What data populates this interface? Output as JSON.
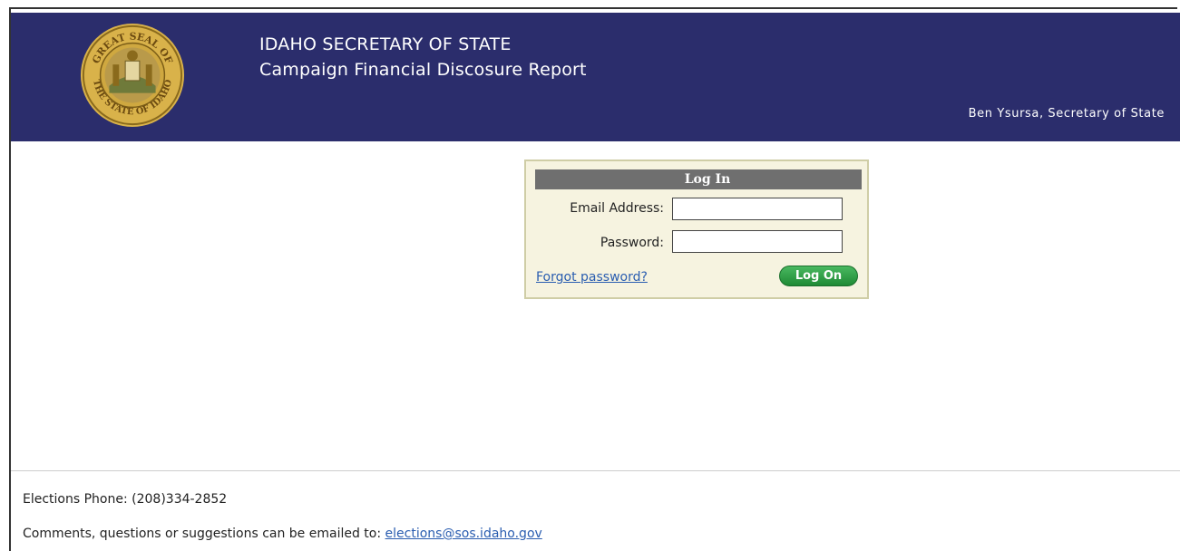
{
  "header": {
    "title_line1": "IDAHO SECRETARY OF STATE",
    "title_line2": "Campaign Financial Discosure Report",
    "official": "Ben Ysursa, Secretary of State",
    "seal": {
      "icon": "idaho-state-seal-icon",
      "top_text": "GREAT SEAL OF",
      "bottom_text": "THE STATE OF IDAHO"
    },
    "background_color": "#2b2d6c"
  },
  "login": {
    "title": "Log In",
    "email_label": "Email Address:",
    "email_value": "",
    "password_label": "Password:",
    "password_value": "",
    "forgot_link": "Forgot password?",
    "logon_button": "Log On",
    "box_background": "#f6f3e0",
    "button_color": "#2a9a44"
  },
  "footer": {
    "phone": "Elections Phone: (208)334-2852",
    "comments_prefix": "Comments, questions or suggestions can be emailed to:",
    "email_link": "elections@sos.idaho.gov",
    "link_color": "#2a5db0"
  }
}
